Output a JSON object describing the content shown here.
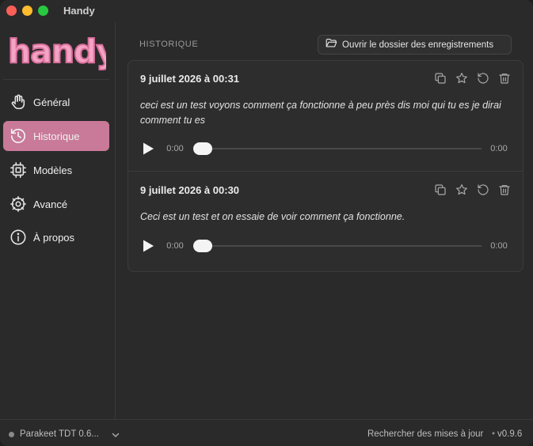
{
  "app": {
    "title": "Handy",
    "logo_text": "handy",
    "accent_color": "#c87a98",
    "logo_color": "#f4a3c4"
  },
  "sidebar": {
    "items": [
      {
        "label": "Général",
        "icon": "hand-icon",
        "active": false
      },
      {
        "label": "Historique",
        "icon": "history-icon",
        "active": true
      },
      {
        "label": "Modèles",
        "icon": "chip-icon",
        "active": false
      },
      {
        "label": "Avancé",
        "icon": "gear-icon",
        "active": false
      },
      {
        "label": "À propos",
        "icon": "info-icon",
        "active": false
      }
    ]
  },
  "main": {
    "section_title": "HISTORIQUE",
    "open_folder_label": "Ouvrir le dossier des enregistrements",
    "entries": [
      {
        "date": "9 juillet 2026 à 00:31",
        "text": "ceci est un test voyons comment ça fonctionne à peu près dis moi qui tu es je dirai comment tu es",
        "current_time": "0:00",
        "duration": "0:00",
        "progress": 0
      },
      {
        "date": "9 juillet 2026 à 00:30",
        "text": "Ceci est un test et on essaie de voir comment ça fonctionne.",
        "current_time": "0:00",
        "duration": "0:00",
        "progress": 0
      }
    ]
  },
  "footer": {
    "model_name": "Parakeet TDT 0.6...",
    "update_label": "Rechercher des mises à jour",
    "separator": "•",
    "version": "v0.9.6"
  }
}
